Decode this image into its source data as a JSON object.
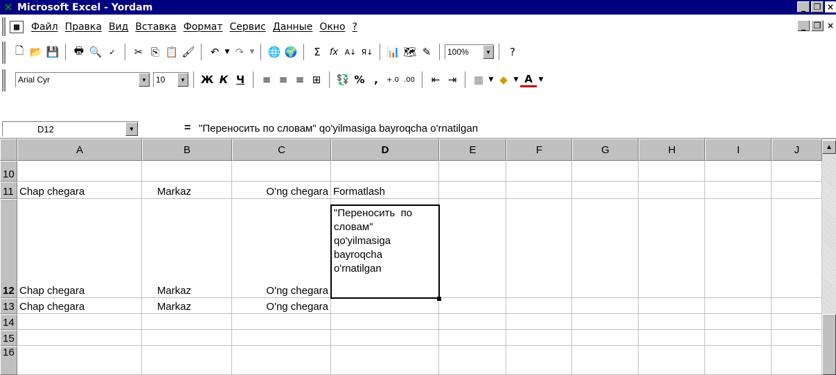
{
  "window": {
    "title": "Microsoft Excel - Yordam",
    "app_icon": "excel-x-icon",
    "buttons": {
      "minimize": "_",
      "restore": "❐",
      "close": "×"
    }
  },
  "menubar": {
    "items": [
      "Файл",
      "Правка",
      "Вид",
      "Вставка",
      "Формат",
      "Сервис",
      "Данные",
      "Окно",
      "?"
    ]
  },
  "toolbar_standard": {
    "icons": [
      "new-icon",
      "open-icon",
      "save-icon",
      "print-icon",
      "print-preview-icon",
      "spelling-icon",
      "cut-icon",
      "copy-icon",
      "paste-icon",
      "format-painter-icon",
      "undo-icon",
      "redo-icon",
      "hyperlink-icon",
      "web-toolbar-icon",
      "autosum-icon",
      "function-icon",
      "sort-ascending-icon",
      "sort-descending-icon",
      "chart-wizard-icon",
      "map-icon",
      "drawing-icon",
      "help-icon"
    ],
    "zoom": "100%"
  },
  "toolbar_formatting": {
    "font": "Arial Cyr",
    "font_size": "10",
    "bold": "Ж",
    "italic": "К",
    "underline": "Ч",
    "percent": "%",
    "comma": ","
  },
  "formula_bar": {
    "name_box": "D12",
    "equals": "=",
    "formula": "\"Переносить по словам\" qo'yilmasiga bayroqcha o'rnatilgan"
  },
  "columns": [
    "A",
    "B",
    "C",
    "D",
    "E",
    "F",
    "G",
    "H",
    "I",
    "J"
  ],
  "rows": [
    {
      "num": "10",
      "cells": {
        "A": "",
        "B": "",
        "C": "",
        "D": ""
      }
    },
    {
      "num": "11",
      "cells": {
        "A": "Chap chegara",
        "B": "Markaz",
        "C": "O'ng chegara",
        "D": "Formatlash"
      }
    },
    {
      "num": "12",
      "cells": {
        "A": "Chap chegara",
        "B": "Markaz",
        "C": "O'ng chegara",
        "D": ""
      }
    },
    {
      "num": "13",
      "cells": {
        "A": "Chap chegara",
        "B": "Markaz",
        "C": "O'ng chegara",
        "D": ""
      }
    },
    {
      "num": "14",
      "cells": {
        "A": "",
        "B": "",
        "C": "",
        "D": ""
      }
    },
    {
      "num": "15",
      "cells": {
        "A": "",
        "B": "",
        "C": "",
        "D": ""
      }
    },
    {
      "num": "16",
      "cells": {
        "A": "",
        "B": "",
        "C": "",
        "D": ""
      }
    }
  ],
  "selected_cell": {
    "ref": "D12",
    "wrapped_lines": [
      "\"Переносить  по",
      "словам\"",
      "qo'yilmasiga",
      "bayroqcha",
      "o'rnatilgan"
    ]
  },
  "colors": {
    "title_bar": "#000080",
    "chrome": "#c0c0c0",
    "gridline": "#c0c0c0"
  }
}
